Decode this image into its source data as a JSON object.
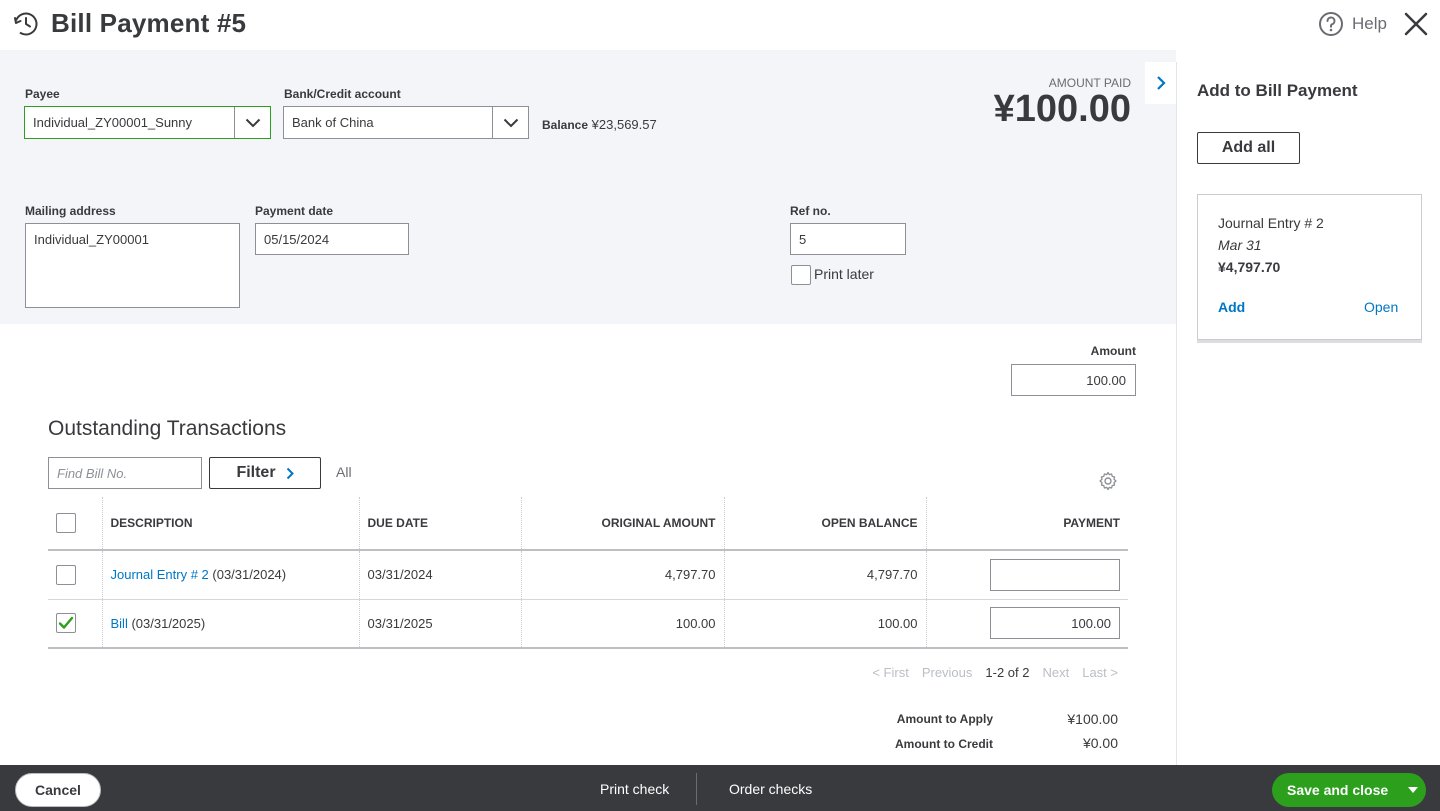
{
  "header": {
    "title": "Bill Payment #5",
    "help_label": "Help"
  },
  "form": {
    "payee_label": "Payee",
    "payee_value": "Individual_ZY00001_Sunny",
    "bank_label": "Bank/Credit account",
    "bank_value": "Bank of China",
    "balance_label": "Balance",
    "balance_value": "¥23,569.57",
    "amount_paid_label": "AMOUNT PAID",
    "amount_paid_value": "¥100.00",
    "mailing_label": "Mailing address",
    "mailing_value": "Individual_ZY00001",
    "payment_date_label": "Payment date",
    "payment_date_value": "05/15/2024",
    "ref_label": "Ref no.",
    "ref_value": "5",
    "print_later_label": "Print later",
    "amount_label": "Amount",
    "amount_value": "100.00"
  },
  "side_panel": {
    "title": "Add to Bill Payment",
    "add_all_label": "Add all",
    "card": {
      "title": "Journal Entry # 2",
      "date": "Mar 31",
      "amount": "¥4,797.70",
      "add_label": "Add",
      "open_label": "Open"
    }
  },
  "outstanding": {
    "title": "Outstanding Transactions",
    "find_placeholder": "Find Bill No.",
    "filter_label": "Filter",
    "all_label": "All",
    "columns": {
      "description": "DESCRIPTION",
      "due_date": "DUE DATE",
      "original_amount": "ORIGINAL AMOUNT",
      "open_balance": "OPEN BALANCE",
      "payment": "PAYMENT"
    },
    "rows": [
      {
        "link": "Journal Entry # 2",
        "desc_suffix": " (03/31/2024)",
        "due_date": "03/31/2024",
        "original_amount": "4,797.70",
        "open_balance": "4,797.70",
        "payment": "",
        "checked": false
      },
      {
        "link": "Bill",
        "desc_suffix": " (03/31/2025)",
        "due_date": "03/31/2025",
        "original_amount": "100.00",
        "open_balance": "100.00",
        "payment": "100.00",
        "checked": true
      }
    ],
    "pager": {
      "first": "< First",
      "previous": "Previous",
      "range": "1-2 of 2",
      "next": "Next",
      "last": "Last >"
    },
    "totals": {
      "apply_label": "Amount to Apply",
      "apply_value": "¥100.00",
      "credit_label": "Amount to Credit",
      "credit_value": "¥0.00"
    }
  },
  "footer": {
    "cancel_label": "Cancel",
    "print_check_label": "Print check",
    "order_checks_label": "Order checks",
    "save_label": "Save and close"
  },
  "colors": {
    "accent_green": "#2ca01c",
    "link_blue": "#0077c5",
    "footer_bg": "#393a3d"
  }
}
